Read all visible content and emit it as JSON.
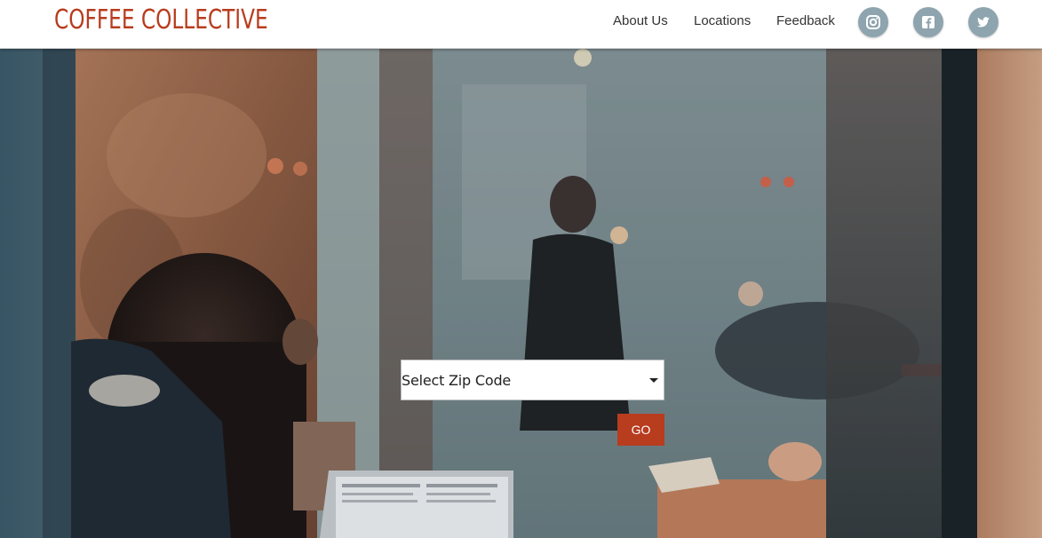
{
  "header": {
    "brand": "COFFEE COLLECTIVE",
    "nav": [
      "About Us",
      "Locations",
      "Feedback"
    ],
    "social": [
      {
        "name": "instagram-icon"
      },
      {
        "name": "facebook-icon"
      },
      {
        "name": "twitter-icon"
      }
    ]
  },
  "search": {
    "zip_placeholder": "Select Zip Code",
    "go_label": "GO"
  },
  "colors": {
    "brand": "#b83c1e",
    "social_bg": "#8ea4ae",
    "header_bg": "#ffffff"
  }
}
